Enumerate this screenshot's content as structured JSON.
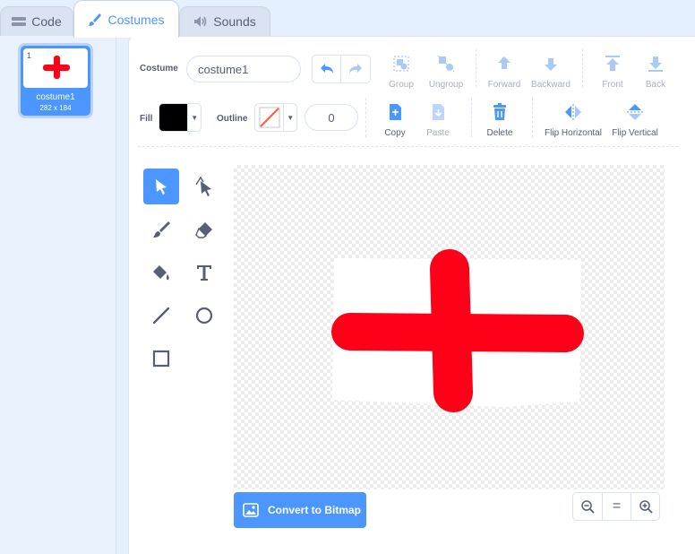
{
  "tabs": {
    "code": "Code",
    "costumes": "Costumes",
    "sounds": "Sounds"
  },
  "costume_list": [
    {
      "number": "1",
      "name": "costume1",
      "size": "282 x 184"
    }
  ],
  "costume_label": "Costume",
  "costume_name": "costume1",
  "toolbar": {
    "group": "Group",
    "ungroup": "Ungroup",
    "forward": "Forward",
    "backward": "Backward",
    "front": "Front",
    "back": "Back",
    "copy": "Copy",
    "paste": "Paste",
    "delete": "Delete",
    "flip_horizontal": "Flip Horizontal",
    "flip_vertical": "Flip Vertical"
  },
  "fill_label": "Fill",
  "outline_label": "Outline",
  "outline_width": "0",
  "colors": {
    "accent": "#4c97ff",
    "fill": "#000000",
    "cross": "#ff0019",
    "text": "#575e75"
  },
  "tools": [
    "select-icon",
    "reshape-icon",
    "brush-icon",
    "eraser-icon",
    "fill-icon",
    "text-icon",
    "line-icon",
    "circle-icon",
    "rectangle-icon"
  ],
  "convert_label": "Convert to Bitmap",
  "zoom": {
    "out": "zoom-out-icon",
    "reset": "=",
    "in": "zoom-in-icon"
  }
}
